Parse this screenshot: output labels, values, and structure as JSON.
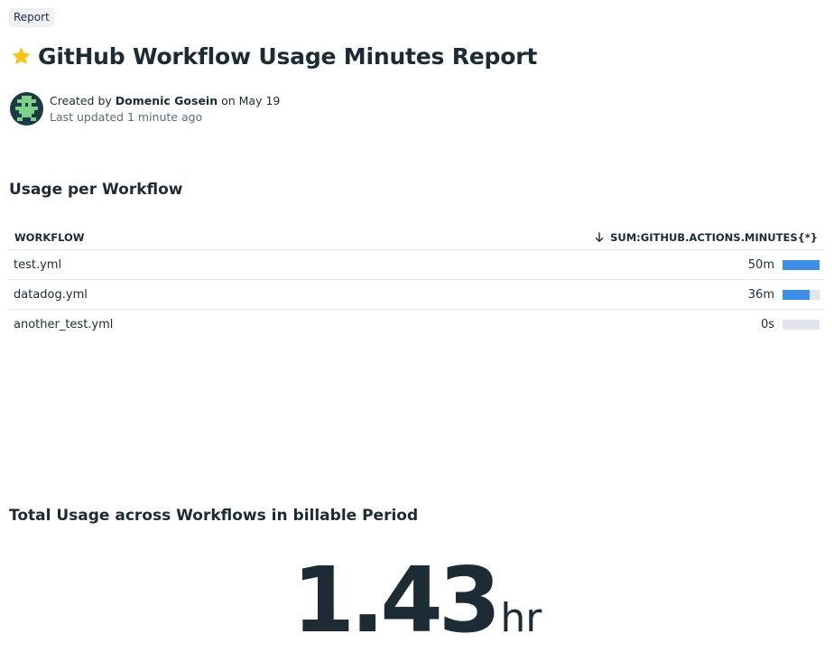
{
  "badge": "Report",
  "title": "GitHub Workflow Usage Minutes Report",
  "author": {
    "prefix": "Created by ",
    "name": "Domenic Gosein",
    "date_text": " on May 19",
    "last_updated": "Last updated 1 minute ago"
  },
  "usage_section": {
    "title": "Usage per Workflow",
    "columns": {
      "workflow": "WORKFLOW",
      "sum": "SUM:GITHUB.ACTIONS.MINUTES{*}"
    },
    "rows": [
      {
        "name": "test.yml",
        "value": "50m",
        "fraction": 1.0
      },
      {
        "name": "datadog.yml",
        "value": "36m",
        "fraction": 0.72
      },
      {
        "name": "another_test.yml",
        "value": "0s",
        "fraction": 0.0
      }
    ]
  },
  "total_section": {
    "title": "Total Usage across Workflows in billable Period",
    "value": "1.43",
    "unit": "hr"
  },
  "icons": {
    "favorite": "star-icon",
    "sort": "arrow-down-icon"
  },
  "colors": {
    "bar_fill": "#3d8ee6",
    "bar_track": "#e2e4ee",
    "star": "#f6c31b",
    "avatar_green": "#7ed08b",
    "avatar_dark": "#1a3a44"
  }
}
